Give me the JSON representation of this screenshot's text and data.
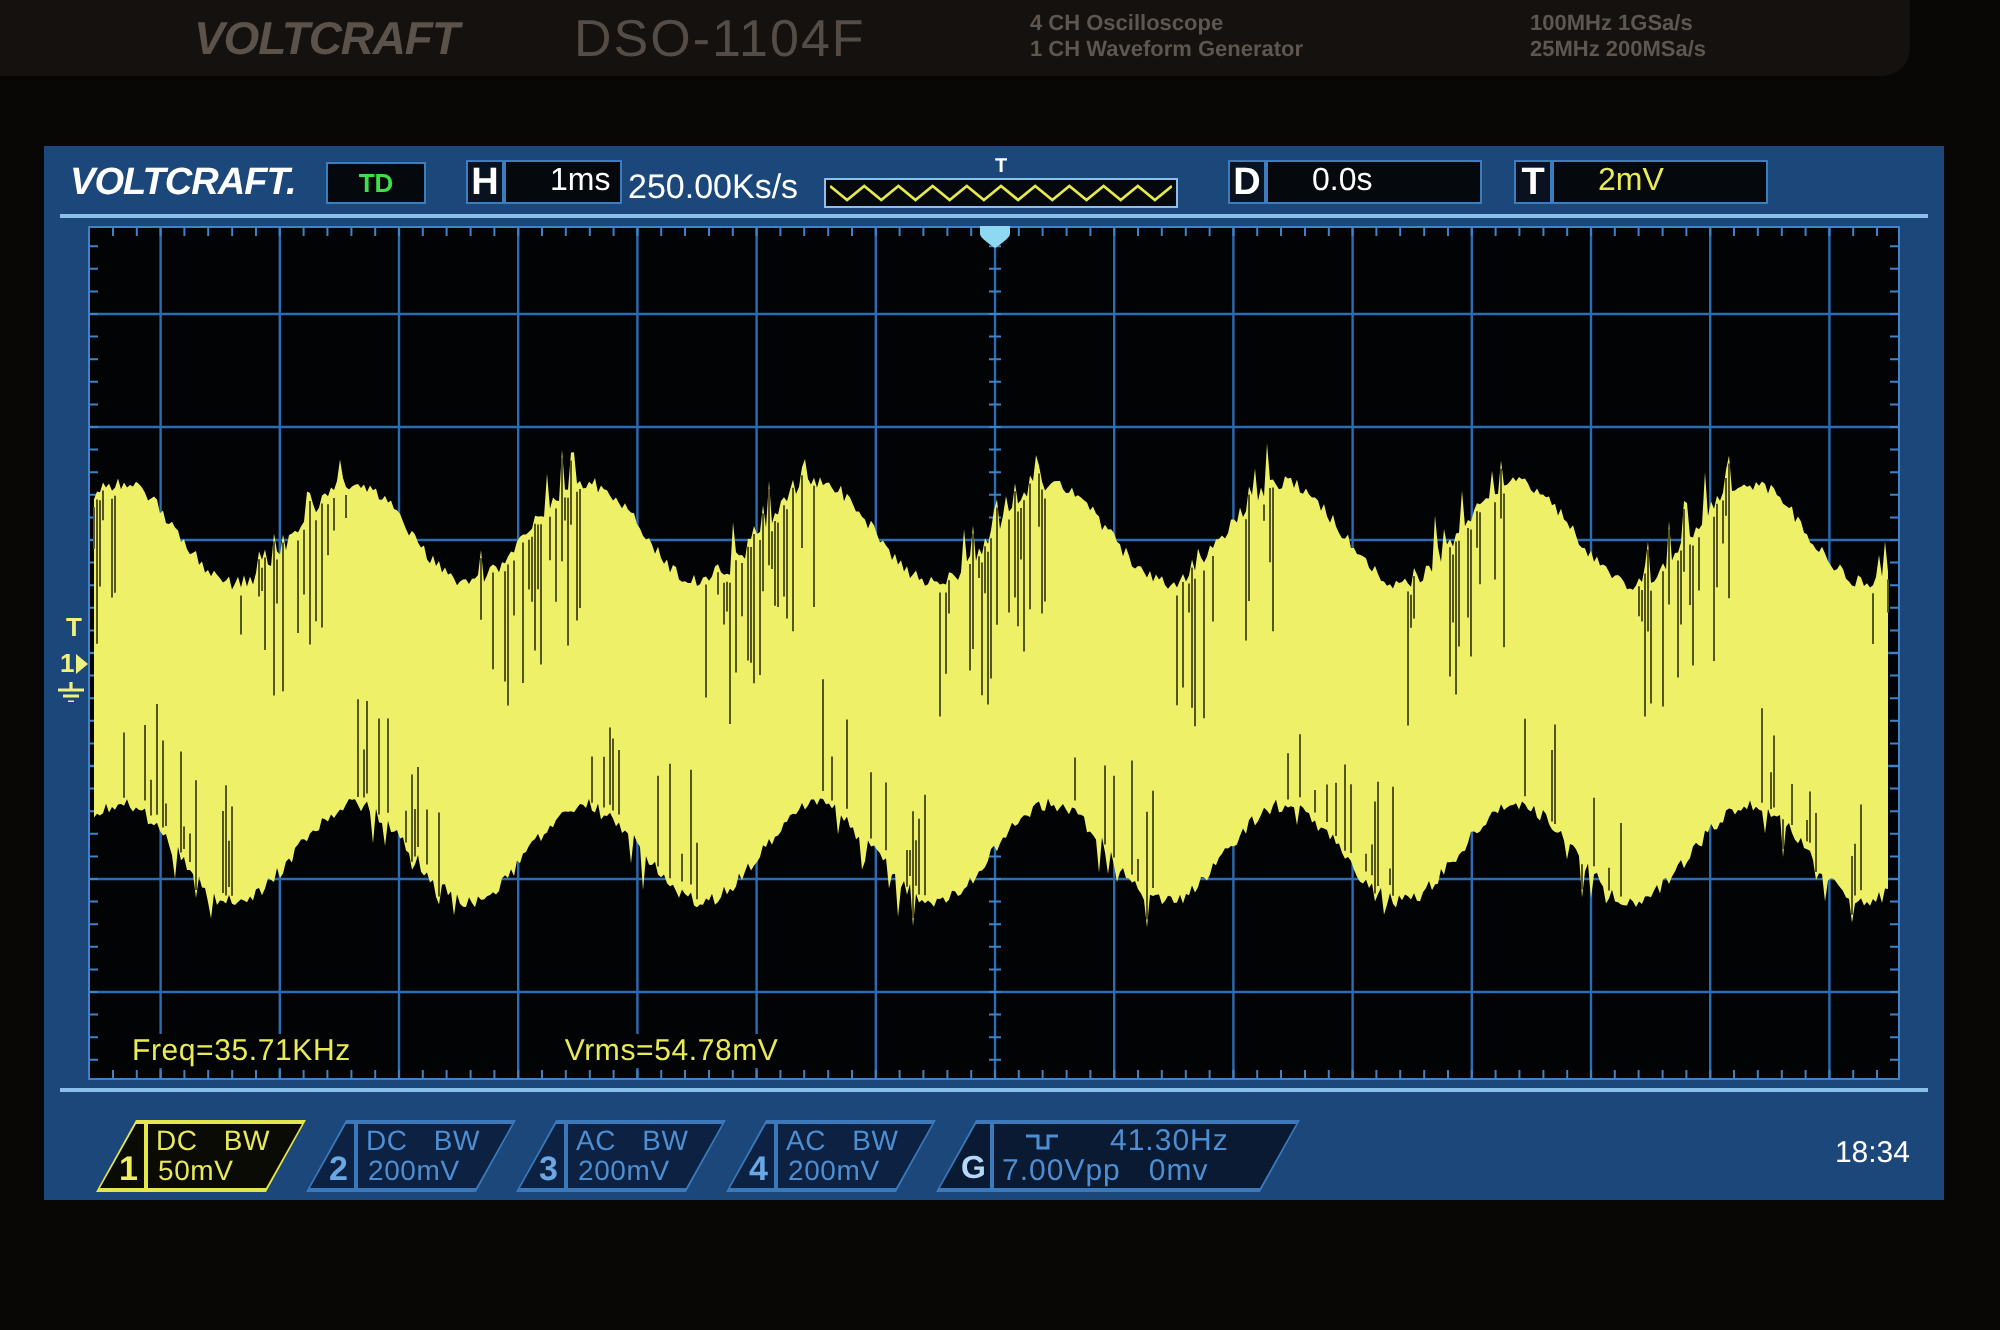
{
  "bezel": {
    "brand": "VOLTCRAFT",
    "model": "DSO-1104F",
    "description": [
      "4 CH Oscilloscope",
      "1 CH Waveform Generator"
    ],
    "specs": [
      "100MHz 1GSa/s",
      "25MHz 200MSa/s"
    ]
  },
  "top_bar": {
    "logo": "VOLTCRAFT.",
    "mode": "TD",
    "horizontal": {
      "label": "H",
      "value": "1ms"
    },
    "sample_rate": "250.00Ks/s",
    "trigger_position_label": "T",
    "delay": {
      "label": "D",
      "value": "0.0s"
    },
    "trigger": {
      "label": "T",
      "value": "2mV"
    }
  },
  "display": {
    "trigger_level_label": "T",
    "channel_marker_label": "1"
  },
  "measurements": [
    "Freq=35.71KHz",
    "Vrms=54.78mV"
  ],
  "channels": [
    {
      "number": "1",
      "coupling": "DC",
      "bandwidth": "BW",
      "scale": "50mV",
      "selected": true
    },
    {
      "number": "2",
      "coupling": "DC",
      "bandwidth": "BW",
      "scale": "200mV",
      "selected": false
    },
    {
      "number": "3",
      "coupling": "AC",
      "bandwidth": "BW",
      "scale": "200mV",
      "selected": false
    },
    {
      "number": "4",
      "coupling": "AC",
      "bandwidth": "BW",
      "scale": "200mV",
      "selected": false
    }
  ],
  "generator": {
    "label": "G",
    "frequency": "41.30Hz",
    "amplitude": "7.00Vpp",
    "offset": "0mv"
  },
  "clock": "18:34"
}
